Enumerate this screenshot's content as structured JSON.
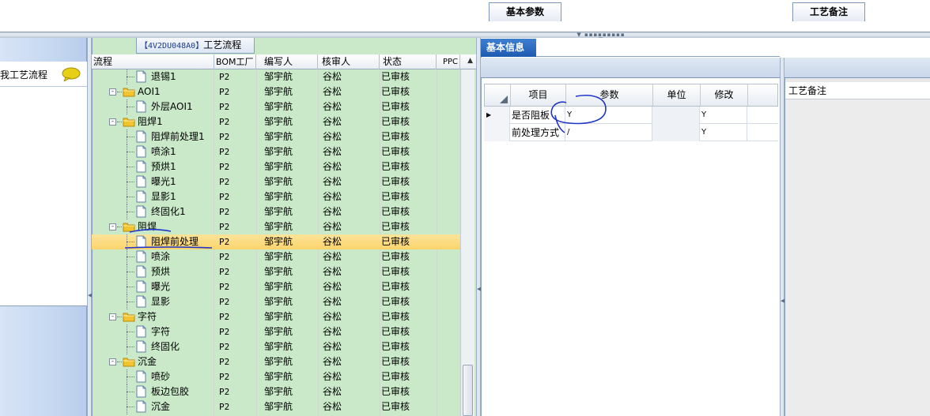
{
  "left_panel": {
    "item_label": "我工艺流程",
    "bubble_icon": "speech-bubble-icon"
  },
  "tree_panel": {
    "title_code": "【4V2DU048A0】",
    "title_text": "工艺流程",
    "columns": [
      "流程",
      "BOM工厂",
      "编写人",
      "核审人",
      "状态",
      "PPC"
    ],
    "rows": [
      {
        "name": "退锡1",
        "level": 2,
        "kind": "doc",
        "bom": "P2",
        "writer": "邹宇航",
        "reviewer": "谷松",
        "status": "已审核"
      },
      {
        "name": "AOI1",
        "level": 1,
        "kind": "folder",
        "bom": "P2",
        "writer": "邹宇航",
        "reviewer": "谷松",
        "status": "已审核"
      },
      {
        "name": "外层AOI1",
        "level": 2,
        "kind": "doc",
        "bom": "P2",
        "writer": "邹宇航",
        "reviewer": "谷松",
        "status": "已审核"
      },
      {
        "name": "阻焊1",
        "level": 1,
        "kind": "folder",
        "bom": "P2",
        "writer": "邹宇航",
        "reviewer": "谷松",
        "status": "已审核"
      },
      {
        "name": "阻焊前处理1",
        "level": 2,
        "kind": "doc",
        "bom": "P2",
        "writer": "邹宇航",
        "reviewer": "谷松",
        "status": "已审核"
      },
      {
        "name": "喷涂1",
        "level": 2,
        "kind": "doc",
        "bom": "P2",
        "writer": "邹宇航",
        "reviewer": "谷松",
        "status": "已审核"
      },
      {
        "name": "预烘1",
        "level": 2,
        "kind": "doc",
        "bom": "P2",
        "writer": "邹宇航",
        "reviewer": "谷松",
        "status": "已审核"
      },
      {
        "name": "曝光1",
        "level": 2,
        "kind": "doc",
        "bom": "P2",
        "writer": "邹宇航",
        "reviewer": "谷松",
        "status": "已审核"
      },
      {
        "name": "显影1",
        "level": 2,
        "kind": "doc",
        "bom": "P2",
        "writer": "邹宇航",
        "reviewer": "谷松",
        "status": "已审核"
      },
      {
        "name": "终固化1",
        "level": 2,
        "kind": "doc",
        "bom": "P2",
        "writer": "邹宇航",
        "reviewer": "谷松",
        "status": "已审核"
      },
      {
        "name": "阻焊",
        "level": 1,
        "kind": "folder",
        "bom": "P2",
        "writer": "邹宇航",
        "reviewer": "谷松",
        "status": "已审核"
      },
      {
        "name": "阻焊前处理",
        "level": 2,
        "kind": "doc",
        "bom": "P2",
        "writer": "邹宇航",
        "reviewer": "谷松",
        "status": "已审核",
        "selected": true
      },
      {
        "name": "喷涂",
        "level": 2,
        "kind": "doc",
        "bom": "P2",
        "writer": "邹宇航",
        "reviewer": "谷松",
        "status": "已审核"
      },
      {
        "name": "预烘",
        "level": 2,
        "kind": "doc",
        "bom": "P2",
        "writer": "邹宇航",
        "reviewer": "谷松",
        "status": "已审核"
      },
      {
        "name": "曝光",
        "level": 2,
        "kind": "doc",
        "bom": "P2",
        "writer": "邹宇航",
        "reviewer": "谷松",
        "status": "已审核"
      },
      {
        "name": "显影",
        "level": 2,
        "kind": "doc",
        "bom": "P2",
        "writer": "邹宇航",
        "reviewer": "谷松",
        "status": "已审核"
      },
      {
        "name": "字符",
        "level": 1,
        "kind": "folder",
        "bom": "P2",
        "writer": "邹宇航",
        "reviewer": "谷松",
        "status": "已审核"
      },
      {
        "name": "字符",
        "level": 2,
        "kind": "doc",
        "bom": "P2",
        "writer": "邹宇航",
        "reviewer": "谷松",
        "status": "已审核"
      },
      {
        "name": "终固化",
        "level": 2,
        "kind": "doc",
        "bom": "P2",
        "writer": "邹宇航",
        "reviewer": "谷松",
        "status": "已审核"
      },
      {
        "name": "沉金",
        "level": 1,
        "kind": "folder",
        "bom": "P2",
        "writer": "邹宇航",
        "reviewer": "谷松",
        "status": "已审核"
      },
      {
        "name": "喷砂",
        "level": 2,
        "kind": "doc",
        "bom": "P2",
        "writer": "邹宇航",
        "reviewer": "谷松",
        "status": "已审核"
      },
      {
        "name": "板边包胶",
        "level": 2,
        "kind": "doc",
        "bom": "P2",
        "writer": "邹宇航",
        "reviewer": "谷松",
        "status": "已审核"
      },
      {
        "name": "沉金",
        "level": 2,
        "kind": "doc",
        "bom": "P2",
        "writer": "邹宇航",
        "reviewer": "谷松",
        "status": "已审核"
      }
    ]
  },
  "info_panel": {
    "tab_label": "基本信息",
    "subtab_label": "基本参数",
    "param_columns": [
      "项目",
      "参数",
      "单位",
      "修改"
    ],
    "params": [
      {
        "item": "是否阻板",
        "value": "Y",
        "unit": "",
        "modify": "Y",
        "current": true
      },
      {
        "item": "前处理方式",
        "value": "/",
        "unit": "",
        "modify": "Y"
      }
    ]
  },
  "notes_panel": {
    "tab_label": "工艺备注",
    "field_label": "工艺备注"
  },
  "colors": {
    "tree_bg": "#c9e9c9",
    "selected_row": "#fbd36b",
    "tab_blue": "#2a66bb",
    "annotation_ink": "#1f35c9"
  }
}
